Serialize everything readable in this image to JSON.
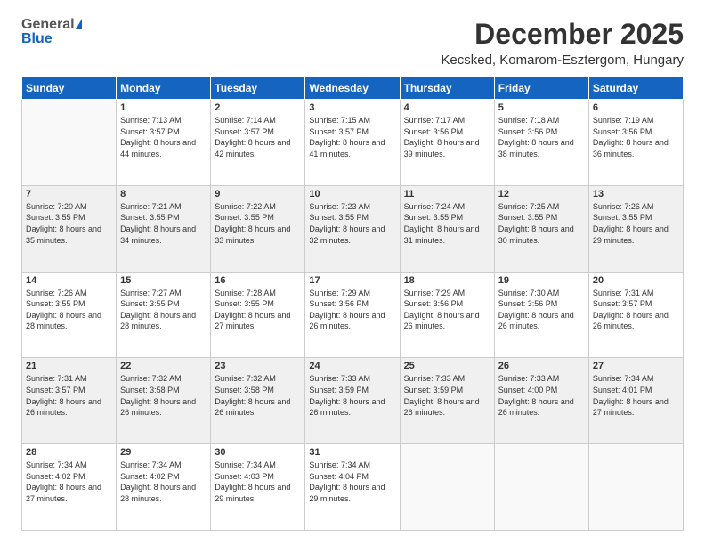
{
  "header": {
    "logo": {
      "general": "General",
      "blue": "Blue"
    },
    "title": "December 2025",
    "subtitle": "Kecsked, Komarom-Esztergom, Hungary"
  },
  "calendar": {
    "weekdays": [
      "Sunday",
      "Monday",
      "Tuesday",
      "Wednesday",
      "Thursday",
      "Friday",
      "Saturday"
    ],
    "weeks": [
      [
        {
          "day": "",
          "sunrise": "",
          "sunset": "",
          "daylight": ""
        },
        {
          "day": "1",
          "sunrise": "Sunrise: 7:13 AM",
          "sunset": "Sunset: 3:57 PM",
          "daylight": "Daylight: 8 hours and 44 minutes."
        },
        {
          "day": "2",
          "sunrise": "Sunrise: 7:14 AM",
          "sunset": "Sunset: 3:57 PM",
          "daylight": "Daylight: 8 hours and 42 minutes."
        },
        {
          "day": "3",
          "sunrise": "Sunrise: 7:15 AM",
          "sunset": "Sunset: 3:57 PM",
          "daylight": "Daylight: 8 hours and 41 minutes."
        },
        {
          "day": "4",
          "sunrise": "Sunrise: 7:17 AM",
          "sunset": "Sunset: 3:56 PM",
          "daylight": "Daylight: 8 hours and 39 minutes."
        },
        {
          "day": "5",
          "sunrise": "Sunrise: 7:18 AM",
          "sunset": "Sunset: 3:56 PM",
          "daylight": "Daylight: 8 hours and 38 minutes."
        },
        {
          "day": "6",
          "sunrise": "Sunrise: 7:19 AM",
          "sunset": "Sunset: 3:56 PM",
          "daylight": "Daylight: 8 hours and 36 minutes."
        }
      ],
      [
        {
          "day": "7",
          "sunrise": "Sunrise: 7:20 AM",
          "sunset": "Sunset: 3:55 PM",
          "daylight": "Daylight: 8 hours and 35 minutes."
        },
        {
          "day": "8",
          "sunrise": "Sunrise: 7:21 AM",
          "sunset": "Sunset: 3:55 PM",
          "daylight": "Daylight: 8 hours and 34 minutes."
        },
        {
          "day": "9",
          "sunrise": "Sunrise: 7:22 AM",
          "sunset": "Sunset: 3:55 PM",
          "daylight": "Daylight: 8 hours and 33 minutes."
        },
        {
          "day": "10",
          "sunrise": "Sunrise: 7:23 AM",
          "sunset": "Sunset: 3:55 PM",
          "daylight": "Daylight: 8 hours and 32 minutes."
        },
        {
          "day": "11",
          "sunrise": "Sunrise: 7:24 AM",
          "sunset": "Sunset: 3:55 PM",
          "daylight": "Daylight: 8 hours and 31 minutes."
        },
        {
          "day": "12",
          "sunrise": "Sunrise: 7:25 AM",
          "sunset": "Sunset: 3:55 PM",
          "daylight": "Daylight: 8 hours and 30 minutes."
        },
        {
          "day": "13",
          "sunrise": "Sunrise: 7:26 AM",
          "sunset": "Sunset: 3:55 PM",
          "daylight": "Daylight: 8 hours and 29 minutes."
        }
      ],
      [
        {
          "day": "14",
          "sunrise": "Sunrise: 7:26 AM",
          "sunset": "Sunset: 3:55 PM",
          "daylight": "Daylight: 8 hours and 28 minutes."
        },
        {
          "day": "15",
          "sunrise": "Sunrise: 7:27 AM",
          "sunset": "Sunset: 3:55 PM",
          "daylight": "Daylight: 8 hours and 28 minutes."
        },
        {
          "day": "16",
          "sunrise": "Sunrise: 7:28 AM",
          "sunset": "Sunset: 3:55 PM",
          "daylight": "Daylight: 8 hours and 27 minutes."
        },
        {
          "day": "17",
          "sunrise": "Sunrise: 7:29 AM",
          "sunset": "Sunset: 3:56 PM",
          "daylight": "Daylight: 8 hours and 26 minutes."
        },
        {
          "day": "18",
          "sunrise": "Sunrise: 7:29 AM",
          "sunset": "Sunset: 3:56 PM",
          "daylight": "Daylight: 8 hours and 26 minutes."
        },
        {
          "day": "19",
          "sunrise": "Sunrise: 7:30 AM",
          "sunset": "Sunset: 3:56 PM",
          "daylight": "Daylight: 8 hours and 26 minutes."
        },
        {
          "day": "20",
          "sunrise": "Sunrise: 7:31 AM",
          "sunset": "Sunset: 3:57 PM",
          "daylight": "Daylight: 8 hours and 26 minutes."
        }
      ],
      [
        {
          "day": "21",
          "sunrise": "Sunrise: 7:31 AM",
          "sunset": "Sunset: 3:57 PM",
          "daylight": "Daylight: 8 hours and 26 minutes."
        },
        {
          "day": "22",
          "sunrise": "Sunrise: 7:32 AM",
          "sunset": "Sunset: 3:58 PM",
          "daylight": "Daylight: 8 hours and 26 minutes."
        },
        {
          "day": "23",
          "sunrise": "Sunrise: 7:32 AM",
          "sunset": "Sunset: 3:58 PM",
          "daylight": "Daylight: 8 hours and 26 minutes."
        },
        {
          "day": "24",
          "sunrise": "Sunrise: 7:33 AM",
          "sunset": "Sunset: 3:59 PM",
          "daylight": "Daylight: 8 hours and 26 minutes."
        },
        {
          "day": "25",
          "sunrise": "Sunrise: 7:33 AM",
          "sunset": "Sunset: 3:59 PM",
          "daylight": "Daylight: 8 hours and 26 minutes."
        },
        {
          "day": "26",
          "sunrise": "Sunrise: 7:33 AM",
          "sunset": "Sunset: 4:00 PM",
          "daylight": "Daylight: 8 hours and 26 minutes."
        },
        {
          "day": "27",
          "sunrise": "Sunrise: 7:34 AM",
          "sunset": "Sunset: 4:01 PM",
          "daylight": "Daylight: 8 hours and 27 minutes."
        }
      ],
      [
        {
          "day": "28",
          "sunrise": "Sunrise: 7:34 AM",
          "sunset": "Sunset: 4:02 PM",
          "daylight": "Daylight: 8 hours and 27 minutes."
        },
        {
          "day": "29",
          "sunrise": "Sunrise: 7:34 AM",
          "sunset": "Sunset: 4:02 PM",
          "daylight": "Daylight: 8 hours and 28 minutes."
        },
        {
          "day": "30",
          "sunrise": "Sunrise: 7:34 AM",
          "sunset": "Sunset: 4:03 PM",
          "daylight": "Daylight: 8 hours and 29 minutes."
        },
        {
          "day": "31",
          "sunrise": "Sunrise: 7:34 AM",
          "sunset": "Sunset: 4:04 PM",
          "daylight": "Daylight: 8 hours and 29 minutes."
        },
        {
          "day": "",
          "sunrise": "",
          "sunset": "",
          "daylight": ""
        },
        {
          "day": "",
          "sunrise": "",
          "sunset": "",
          "daylight": ""
        },
        {
          "day": "",
          "sunrise": "",
          "sunset": "",
          "daylight": ""
        }
      ]
    ]
  }
}
